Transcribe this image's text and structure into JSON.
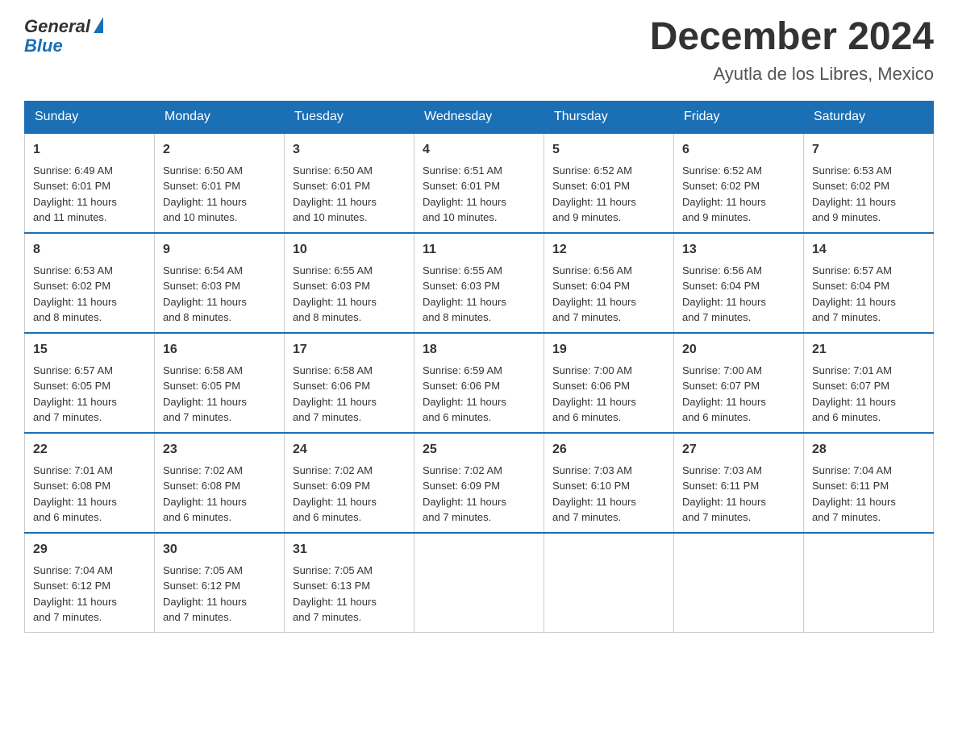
{
  "header": {
    "logo_general": "General",
    "logo_blue": "Blue",
    "month_title": "December 2024",
    "location": "Ayutla de los Libres, Mexico"
  },
  "days_of_week": [
    "Sunday",
    "Monday",
    "Tuesday",
    "Wednesday",
    "Thursday",
    "Friday",
    "Saturday"
  ],
  "weeks": [
    [
      {
        "day": "1",
        "info": "Sunrise: 6:49 AM\nSunset: 6:01 PM\nDaylight: 11 hours\nand 11 minutes."
      },
      {
        "day": "2",
        "info": "Sunrise: 6:50 AM\nSunset: 6:01 PM\nDaylight: 11 hours\nand 10 minutes."
      },
      {
        "day": "3",
        "info": "Sunrise: 6:50 AM\nSunset: 6:01 PM\nDaylight: 11 hours\nand 10 minutes."
      },
      {
        "day": "4",
        "info": "Sunrise: 6:51 AM\nSunset: 6:01 PM\nDaylight: 11 hours\nand 10 minutes."
      },
      {
        "day": "5",
        "info": "Sunrise: 6:52 AM\nSunset: 6:01 PM\nDaylight: 11 hours\nand 9 minutes."
      },
      {
        "day": "6",
        "info": "Sunrise: 6:52 AM\nSunset: 6:02 PM\nDaylight: 11 hours\nand 9 minutes."
      },
      {
        "day": "7",
        "info": "Sunrise: 6:53 AM\nSunset: 6:02 PM\nDaylight: 11 hours\nand 9 minutes."
      }
    ],
    [
      {
        "day": "8",
        "info": "Sunrise: 6:53 AM\nSunset: 6:02 PM\nDaylight: 11 hours\nand 8 minutes."
      },
      {
        "day": "9",
        "info": "Sunrise: 6:54 AM\nSunset: 6:03 PM\nDaylight: 11 hours\nand 8 minutes."
      },
      {
        "day": "10",
        "info": "Sunrise: 6:55 AM\nSunset: 6:03 PM\nDaylight: 11 hours\nand 8 minutes."
      },
      {
        "day": "11",
        "info": "Sunrise: 6:55 AM\nSunset: 6:03 PM\nDaylight: 11 hours\nand 8 minutes."
      },
      {
        "day": "12",
        "info": "Sunrise: 6:56 AM\nSunset: 6:04 PM\nDaylight: 11 hours\nand 7 minutes."
      },
      {
        "day": "13",
        "info": "Sunrise: 6:56 AM\nSunset: 6:04 PM\nDaylight: 11 hours\nand 7 minutes."
      },
      {
        "day": "14",
        "info": "Sunrise: 6:57 AM\nSunset: 6:04 PM\nDaylight: 11 hours\nand 7 minutes."
      }
    ],
    [
      {
        "day": "15",
        "info": "Sunrise: 6:57 AM\nSunset: 6:05 PM\nDaylight: 11 hours\nand 7 minutes."
      },
      {
        "day": "16",
        "info": "Sunrise: 6:58 AM\nSunset: 6:05 PM\nDaylight: 11 hours\nand 7 minutes."
      },
      {
        "day": "17",
        "info": "Sunrise: 6:58 AM\nSunset: 6:06 PM\nDaylight: 11 hours\nand 7 minutes."
      },
      {
        "day": "18",
        "info": "Sunrise: 6:59 AM\nSunset: 6:06 PM\nDaylight: 11 hours\nand 6 minutes."
      },
      {
        "day": "19",
        "info": "Sunrise: 7:00 AM\nSunset: 6:06 PM\nDaylight: 11 hours\nand 6 minutes."
      },
      {
        "day": "20",
        "info": "Sunrise: 7:00 AM\nSunset: 6:07 PM\nDaylight: 11 hours\nand 6 minutes."
      },
      {
        "day": "21",
        "info": "Sunrise: 7:01 AM\nSunset: 6:07 PM\nDaylight: 11 hours\nand 6 minutes."
      }
    ],
    [
      {
        "day": "22",
        "info": "Sunrise: 7:01 AM\nSunset: 6:08 PM\nDaylight: 11 hours\nand 6 minutes."
      },
      {
        "day": "23",
        "info": "Sunrise: 7:02 AM\nSunset: 6:08 PM\nDaylight: 11 hours\nand 6 minutes."
      },
      {
        "day": "24",
        "info": "Sunrise: 7:02 AM\nSunset: 6:09 PM\nDaylight: 11 hours\nand 6 minutes."
      },
      {
        "day": "25",
        "info": "Sunrise: 7:02 AM\nSunset: 6:09 PM\nDaylight: 11 hours\nand 7 minutes."
      },
      {
        "day": "26",
        "info": "Sunrise: 7:03 AM\nSunset: 6:10 PM\nDaylight: 11 hours\nand 7 minutes."
      },
      {
        "day": "27",
        "info": "Sunrise: 7:03 AM\nSunset: 6:11 PM\nDaylight: 11 hours\nand 7 minutes."
      },
      {
        "day": "28",
        "info": "Sunrise: 7:04 AM\nSunset: 6:11 PM\nDaylight: 11 hours\nand 7 minutes."
      }
    ],
    [
      {
        "day": "29",
        "info": "Sunrise: 7:04 AM\nSunset: 6:12 PM\nDaylight: 11 hours\nand 7 minutes."
      },
      {
        "day": "30",
        "info": "Sunrise: 7:05 AM\nSunset: 6:12 PM\nDaylight: 11 hours\nand 7 minutes."
      },
      {
        "day": "31",
        "info": "Sunrise: 7:05 AM\nSunset: 6:13 PM\nDaylight: 11 hours\nand 7 minutes."
      },
      null,
      null,
      null,
      null
    ]
  ]
}
